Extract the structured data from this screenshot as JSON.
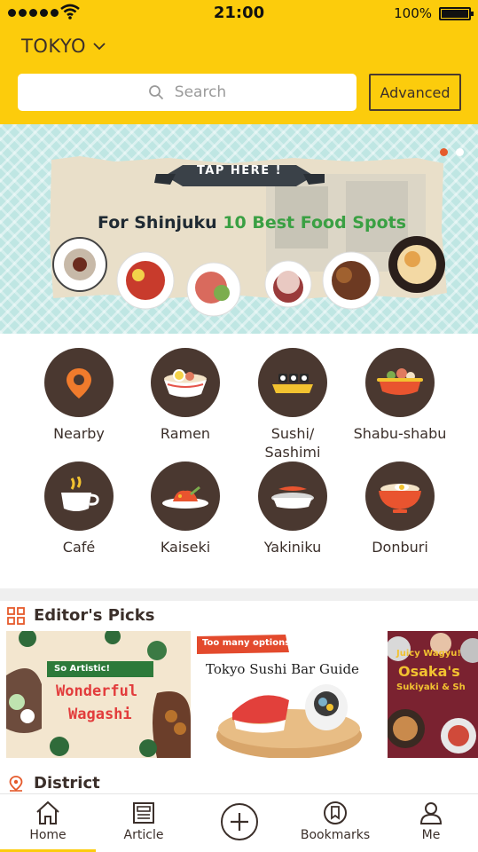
{
  "status_bar": {
    "time": "21:00",
    "battery": "100%"
  },
  "header": {
    "city": "TOKYO",
    "search_placeholder": "Search",
    "advanced_label": "Advanced",
    "brand_color": "#fccc0c"
  },
  "banner": {
    "tap_text": "TAP HERE !",
    "title_prefix": "For Shinjuku",
    "title_highlight": "10 Best Food Spots",
    "slide_count": 2,
    "active_slide": 1
  },
  "categories": [
    {
      "label": "Nearby",
      "icon": "map-pin-icon"
    },
    {
      "label": "Ramen",
      "icon": "ramen-bowl-icon"
    },
    {
      "label": "Sushi/\nSashimi",
      "icon": "sushi-icon"
    },
    {
      "label": "Shabu-shabu",
      "icon": "hot-pot-icon"
    },
    {
      "label": "Café",
      "icon": "coffee-cup-icon"
    },
    {
      "label": "Kaiseki",
      "icon": "kaiseki-plate-icon"
    },
    {
      "label": "Yakiniku",
      "icon": "grill-icon"
    },
    {
      "label": "Donburi",
      "icon": "rice-bowl-icon"
    }
  ],
  "editors_picks": {
    "title": "Editor's Picks",
    "items": [
      {
        "tag": "So Artistic!",
        "title_line1": "Wonderful",
        "title_line2": "Wagashi"
      },
      {
        "tag": "Too many options?",
        "title": "Tokyo Sushi Bar Guide"
      },
      {
        "tag": "Juicy Wagyu!",
        "title_line1": "Osaka's",
        "title_line2": "Sukiyaki & Sh"
      }
    ]
  },
  "district": {
    "title": "District"
  },
  "tabs": [
    {
      "label": "Home",
      "icon": "home-icon",
      "active": true
    },
    {
      "label": "Article",
      "icon": "article-icon",
      "active": false
    },
    {
      "label": "",
      "icon": "add-icon",
      "active": false
    },
    {
      "label": "Bookmarks",
      "icon": "bookmark-icon",
      "active": false
    },
    {
      "label": "Me",
      "icon": "user-icon",
      "active": false
    }
  ]
}
